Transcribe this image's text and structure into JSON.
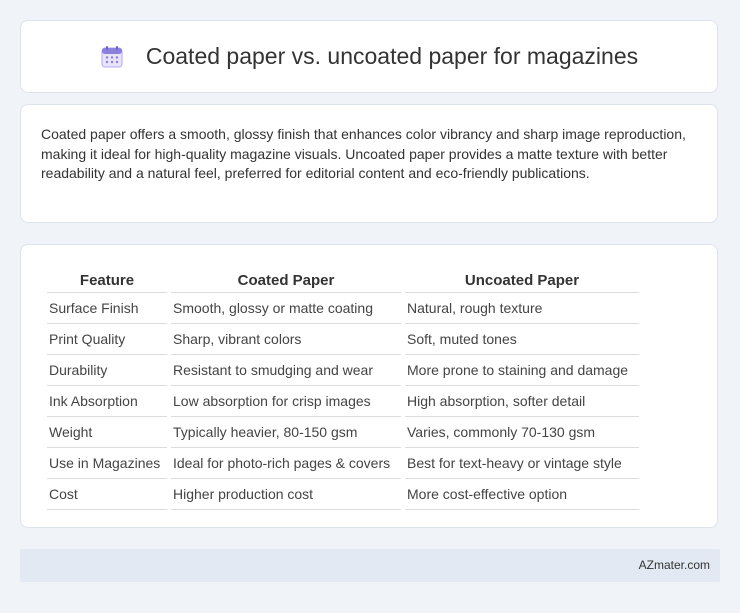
{
  "header": {
    "title": "Coated paper vs. uncoated paper for magazines",
    "icon": "calendar-icon",
    "icon_color": "#8b7fe0"
  },
  "intro": {
    "text": "Coated paper offers a smooth, glossy finish that enhances color vibrancy and sharp image reproduction, making it ideal for high-quality magazine visuals. Uncoated paper provides a matte texture with better readability and a natural feel, preferred for editorial content and eco-friendly publications."
  },
  "table": {
    "headers": [
      "Feature",
      "Coated Paper",
      "Uncoated Paper"
    ],
    "rows": [
      [
        "Surface Finish",
        "Smooth, glossy or matte coating",
        "Natural, rough texture"
      ],
      [
        "Print Quality",
        "Sharp, vibrant colors",
        "Soft, muted tones"
      ],
      [
        "Durability",
        "Resistant to smudging and wear",
        "More prone to staining and damage"
      ],
      [
        "Ink Absorption",
        "Low absorption for crisp images",
        "High absorption, softer detail"
      ],
      [
        "Weight",
        "Typically heavier, 80-150 gsm",
        "Varies, commonly 70-130 gsm"
      ],
      [
        "Use in Magazines",
        "Ideal for photo-rich pages & covers",
        "Best for text-heavy or vintage style"
      ],
      [
        "Cost",
        "Higher production cost",
        "More cost-effective option"
      ]
    ]
  },
  "footer": {
    "brand": "AZmater.com"
  }
}
